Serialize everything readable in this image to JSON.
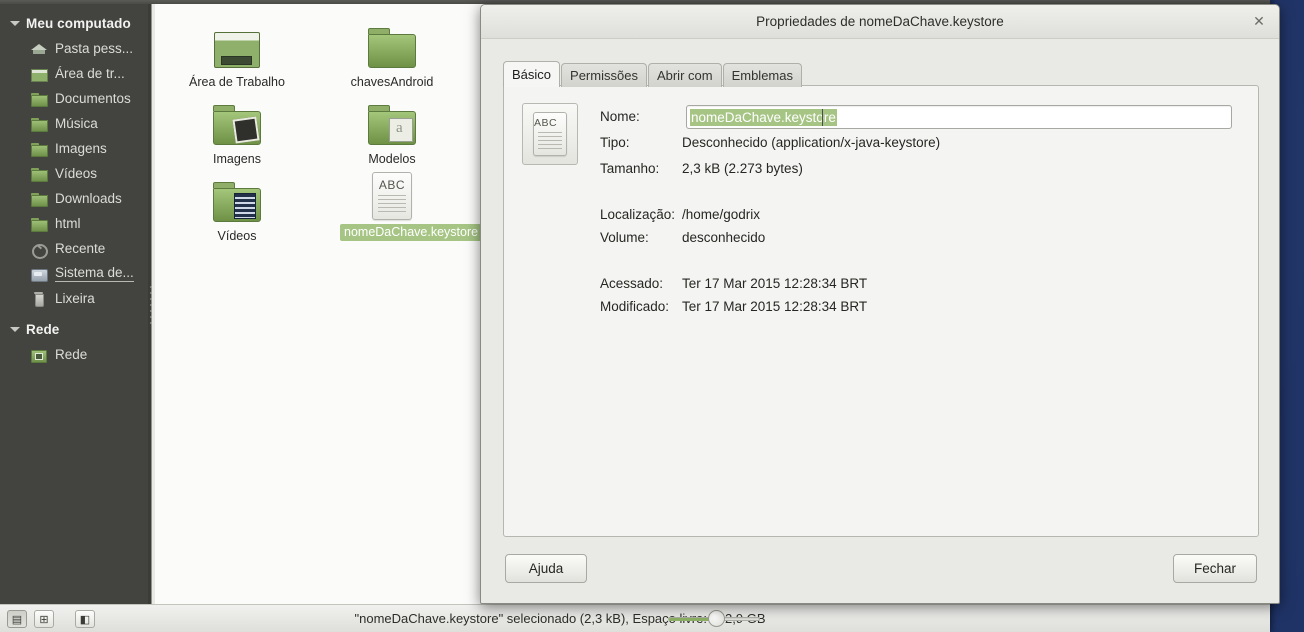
{
  "desktop": {
    "background_color": "#1f3366"
  },
  "filemanager": {
    "sidebar": {
      "groups": [
        {
          "label": "Meu computado",
          "icon": "chevron-down-icon",
          "items": [
            {
              "label": "Pasta pess...",
              "icon": "home-folder-icon",
              "hovered": false
            },
            {
              "label": "Área de tr...",
              "icon": "desktop-folder-icon",
              "hovered": false
            },
            {
              "label": "Documentos",
              "icon": "documents-folder-icon",
              "hovered": false
            },
            {
              "label": "Música",
              "icon": "music-folder-icon",
              "hovered": false
            },
            {
              "label": "Imagens",
              "icon": "pictures-folder-icon",
              "hovered": false
            },
            {
              "label": "Vídeos",
              "icon": "videos-folder-icon",
              "hovered": false
            },
            {
              "label": "Downloads",
              "icon": "downloads-folder-icon",
              "hovered": false
            },
            {
              "label": "html",
              "icon": "folder-icon",
              "hovered": false
            },
            {
              "label": "Recente",
              "icon": "recent-icon",
              "hovered": false
            },
            {
              "label": "Sistema de...",
              "icon": "filesystem-disk-icon",
              "hovered": true
            },
            {
              "label": "Lixeira",
              "icon": "trash-icon",
              "hovered": false
            }
          ]
        },
        {
          "label": "Rede",
          "icon": "chevron-down-icon",
          "items": [
            {
              "label": "Rede",
              "icon": "network-folder-icon",
              "hovered": false
            }
          ]
        }
      ]
    },
    "iconview": {
      "items": [
        {
          "name": "Área de Trabalho",
          "icon": "desktop-folder-icon",
          "selected": false
        },
        {
          "name": "chavesAndroid",
          "icon": "folder-icon",
          "selected": false
        },
        {
          "name": "Imagens",
          "icon": "pictures-folder-icon",
          "selected": false
        },
        {
          "name": "Modelos",
          "icon": "templates-folder-icon",
          "selected": false
        },
        {
          "name": "Vídeos",
          "icon": "videos-folder-icon",
          "selected": false
        },
        {
          "name": "nomeDaChave.keystore",
          "icon": "abc-document-icon",
          "selected": true
        }
      ],
      "selection_color": "#a6c585"
    },
    "statusbar": {
      "text": "\"nomeDaChave.keystore\" selecionado (2,3 kB), Espaço livre: 852,9 GB",
      "buttons": [
        {
          "name": "icon-view-button",
          "icon": "icon-view-icon",
          "pressed": true
        },
        {
          "name": "list-view-button",
          "icon": "tree-view-icon",
          "pressed": false
        },
        {
          "name": "sidebar-toggle-button",
          "icon": "sidebar-panel-icon",
          "pressed": false
        }
      ],
      "zoom_slider": {
        "value": 45,
        "min": 0,
        "max": 100,
        "fill_color": "#8db063"
      }
    }
  },
  "dialog": {
    "title": "Propriedades de nomeDaChave.keystore",
    "close_icon": "close-icon",
    "tabs": [
      {
        "label": "Básico",
        "active": true
      },
      {
        "label": "Permissões",
        "active": false
      },
      {
        "label": "Abrir com",
        "active": false
      },
      {
        "label": "Emblemas",
        "active": false
      }
    ],
    "basic": {
      "file_icon": "abc-document-icon",
      "name_label": "Nome:",
      "name_value": "nomeDaChave.keystore",
      "name_value_selected": true,
      "rows": [
        {
          "label": "Tipo:",
          "value": "Desconhecido (application/x-java-keystore)"
        },
        {
          "label": "Tamanho:",
          "value": "2,3 kB (2.273 bytes)"
        },
        {
          "label": "Localização:",
          "value": "/home/godrix"
        },
        {
          "label": "Volume:",
          "value": "desconhecido"
        },
        {
          "label": "Acessado:",
          "value": "Ter 17 Mar 2015 12:28:34 BRT"
        },
        {
          "label": "Modificado:",
          "value": "Ter 17 Mar 2015 12:28:34 BRT"
        }
      ]
    },
    "help_label": "Ajuda",
    "close_label": "Fechar"
  }
}
